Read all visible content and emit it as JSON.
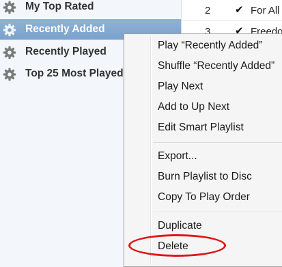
{
  "sidebar": {
    "items": [
      {
        "label": "My Top Rated",
        "icon": "gear-icon",
        "selected": false
      },
      {
        "label": "Recently Added",
        "icon": "gear-icon",
        "selected": true
      },
      {
        "label": "Recently Played",
        "icon": "gear-icon",
        "selected": false
      },
      {
        "label": "Top 25 Most Played",
        "icon": "gear-icon",
        "selected": false
      }
    ]
  },
  "tracks": [
    {
      "number": "2",
      "checked": "✔",
      "title": "For All"
    },
    {
      "number": "3",
      "checked": "✔",
      "title": "Freedom"
    }
  ],
  "context_menu": {
    "items": [
      "Play “Recently Added”",
      "Shuffle “Recently Added”",
      "Play Next",
      "Add to Up Next",
      "Edit Smart Playlist",
      "Export...",
      "Burn Playlist to Disc",
      "Copy To Play Order",
      "Duplicate",
      "Delete"
    ],
    "highlighted_item": "Delete"
  },
  "colors": {
    "selection": "#7ba2cc",
    "highlight_circle": "#e0161b"
  }
}
